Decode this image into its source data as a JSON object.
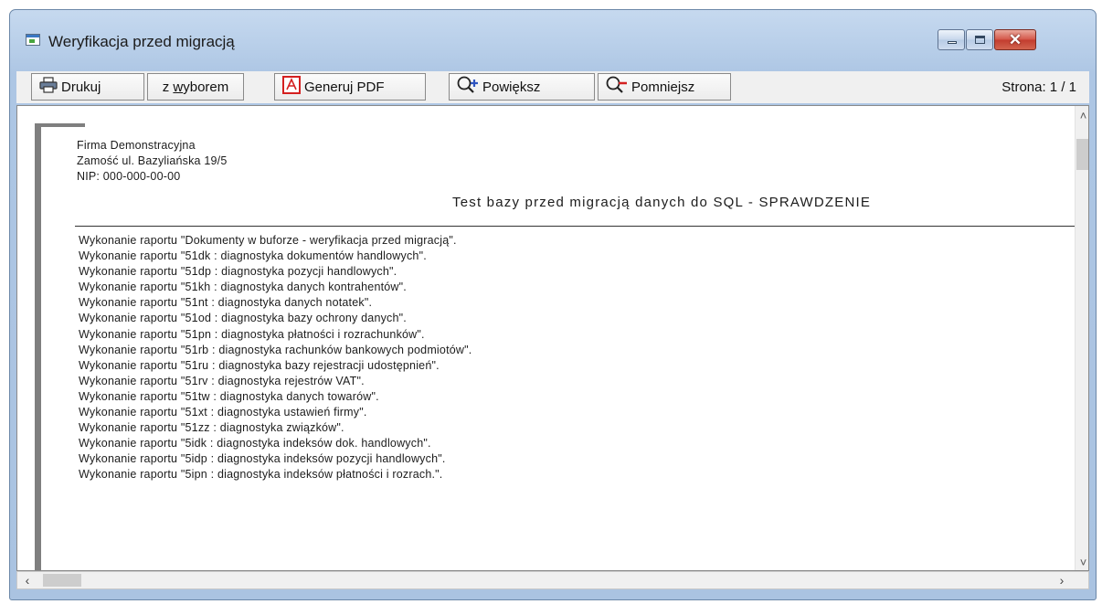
{
  "window": {
    "title": "Weryfikacja przed migracją"
  },
  "window_controls": {
    "minimize": "minimize",
    "maximize": "maximize",
    "close": "close"
  },
  "toolbar": {
    "print_label": "Drukuj",
    "select_label_prefix": "z ",
    "select_label_underlined": "w",
    "select_label_suffix": "yborem",
    "pdf_label": "Generuj PDF",
    "zoom_in_label": "Powiększ",
    "zoom_out_label": "Pomniejsz",
    "page_indicator": "Strona: 1 / 1"
  },
  "icons": {
    "print": "printer-icon",
    "pdf": "pdf-icon",
    "zoom_in": "zoom-in-icon",
    "zoom_out": "zoom-out-icon"
  },
  "colors": {
    "titlebar": "#b6cde8",
    "close_button": "#c23d2f",
    "pdf_icon": "#d42020",
    "page_shadow": "#7f7f7f"
  },
  "document": {
    "company_name": "Firma Demonstracyjna",
    "company_address": "Zamość ul. Bazyliańska 19/5",
    "company_nip": "NIP: 000-000-00-00",
    "report_title": "Test bazy przed migracją danych do SQL - SPRAWDZENIE",
    "lines": [
      "Wykonanie raportu \"Dokumenty w buforze - weryfikacja przed migracją\".",
      "Wykonanie raportu \"51dk : diagnostyka dokumentów handlowych\".",
      "Wykonanie raportu \"51dp : diagnostyka pozycji handlowych\".",
      "Wykonanie raportu \"51kh : diagnostyka danych kontrahentów\".",
      "Wykonanie raportu \"51nt : diagnostyka danych notatek\".",
      "Wykonanie raportu \"51od : diagnostyka bazy ochrony danych\".",
      "Wykonanie raportu \"51pn : diagnostyka płatności i rozrachunków\".",
      "Wykonanie raportu \"51rb : diagnostyka rachunków bankowych podmiotów\".",
      "Wykonanie raportu \"51ru : diagnostyka bazy rejestracji udostępnień\".",
      "Wykonanie raportu \"51rv : diagnostyka rejestrów VAT\".",
      "Wykonanie raportu \"51tw : diagnostyka danych towarów\".",
      "Wykonanie raportu \"51xt : diagnostyka ustawień firmy\".",
      "Wykonanie raportu \"51zz : diagnostyka związków\".",
      "Wykonanie raportu \"5idk : diagnostyka indeksów dok. handlowych\".",
      "Wykonanie raportu \"5idp : diagnostyka indeksów pozycji handlowych\".",
      "Wykonanie raportu \"5ipn : diagnostyka indeksów płatności i rozrach.\"."
    ]
  },
  "scrollbars": {
    "vertical_position": 0,
    "horizontal_position": 0
  }
}
